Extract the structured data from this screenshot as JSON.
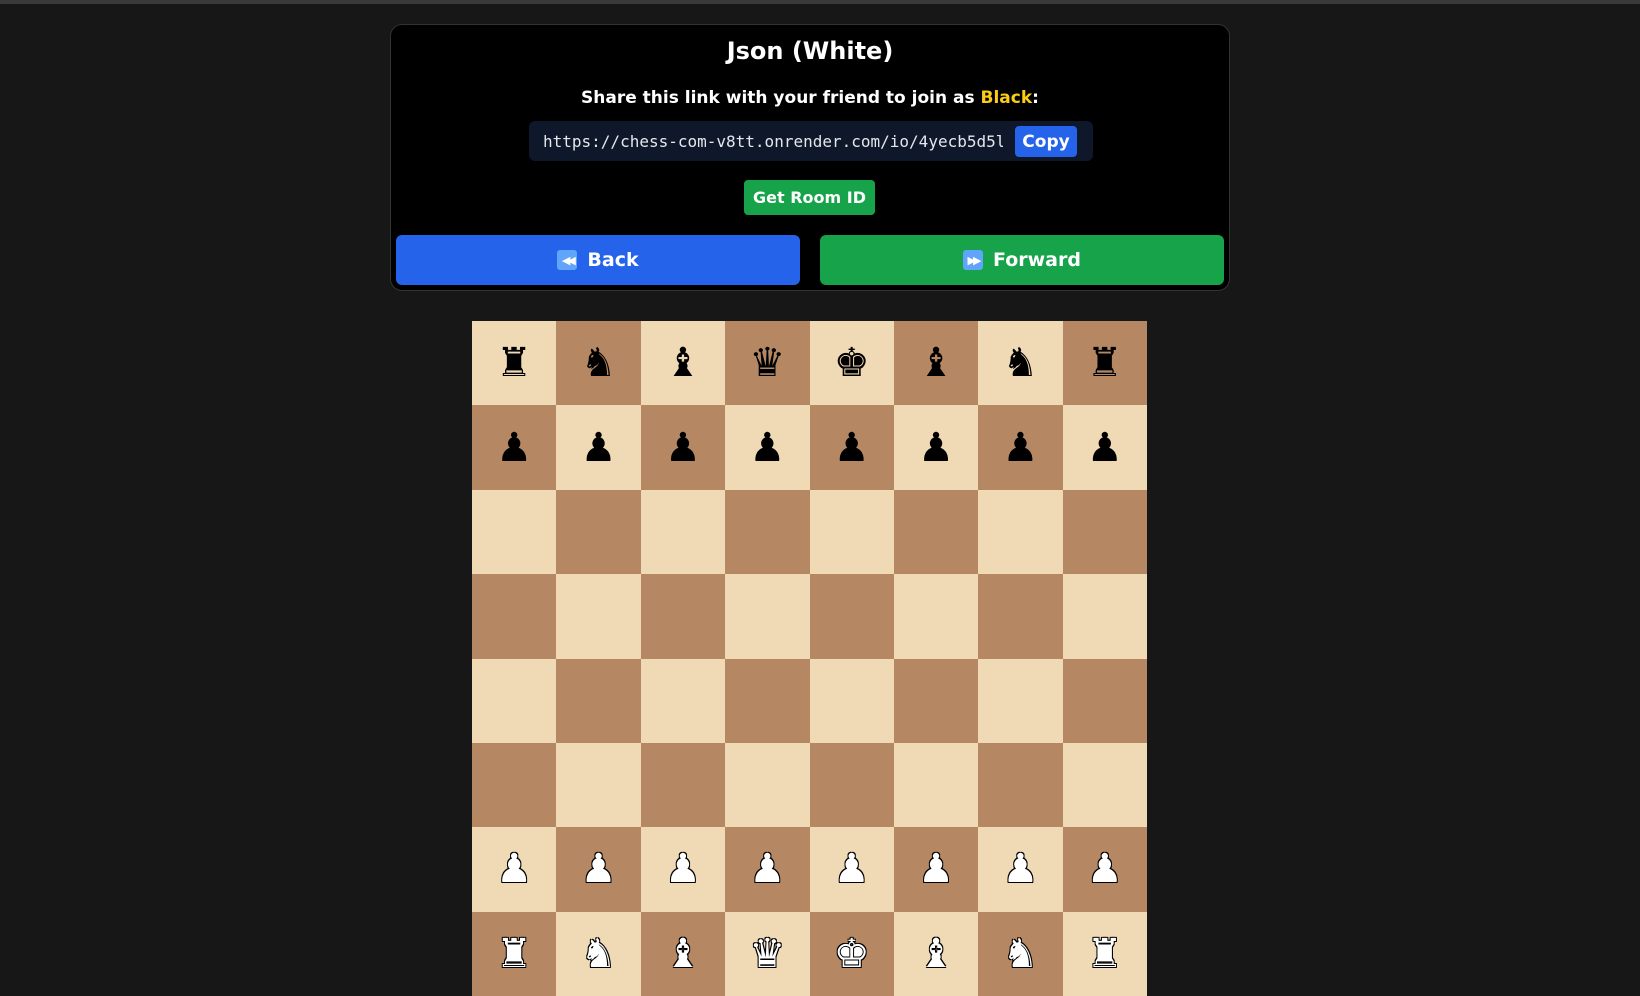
{
  "header": {
    "title": "Json (White)",
    "share_prefix": "Share this link with your friend to join as ",
    "share_role": "Black",
    "share_suffix": ":"
  },
  "link": {
    "value": "https://chess-com-v8tt.onrender.com/io/4yecb5d5l",
    "copy_label": "Copy"
  },
  "room_button": {
    "label": "Get Room ID"
  },
  "navigation": {
    "back_label": "Back",
    "back_icon": "rewind-icon",
    "forward_label": "Forward",
    "forward_icon": "fast-forward-icon"
  },
  "colors": {
    "accent_yellow": "#facc15",
    "blue": "#2563eb",
    "green": "#16a34a",
    "light_square": "#f0d9b5",
    "dark_square": "#b58863"
  },
  "board": {
    "orientation": "white",
    "ranks": [
      [
        "bR",
        "bN",
        "bB",
        "bQ",
        "bK",
        "bB",
        "bN",
        "bR"
      ],
      [
        "bP",
        "bP",
        "bP",
        "bP",
        "bP",
        "bP",
        "bP",
        "bP"
      ],
      [
        "",
        "",
        "",
        "",
        "",
        "",
        "",
        ""
      ],
      [
        "",
        "",
        "",
        "",
        "",
        "",
        "",
        ""
      ],
      [
        "",
        "",
        "",
        "",
        "",
        "",
        "",
        ""
      ],
      [
        "",
        "",
        "",
        "",
        "",
        "",
        "",
        ""
      ],
      [
        "wP",
        "wP",
        "wP",
        "wP",
        "wP",
        "wP",
        "wP",
        "wP"
      ],
      [
        "wR",
        "wN",
        "wB",
        "wQ",
        "wK",
        "wB",
        "wN",
        "wR"
      ]
    ]
  }
}
